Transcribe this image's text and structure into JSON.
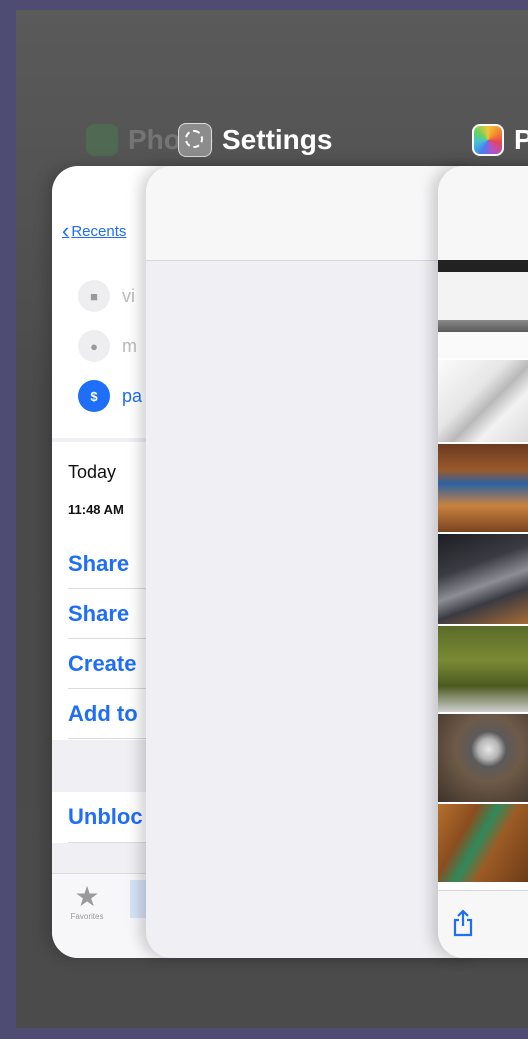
{
  "app_switcher": {
    "apps": [
      {
        "name": "Phone",
        "icon": "phone-icon",
        "dimmed": true
      },
      {
        "name": "Settings",
        "icon": "settings-gear-icon",
        "dimmed": false
      },
      {
        "name": "Photos",
        "icon": "photos-icon",
        "dimmed": false
      }
    ]
  },
  "phone_card": {
    "back_label": "Recents",
    "actions": [
      {
        "icon": "video-icon",
        "label": "vi"
      },
      {
        "icon": "message-icon",
        "label": "m"
      },
      {
        "icon": "pay-icon",
        "glyph": "$",
        "label": "pa"
      }
    ],
    "date_label": "Today",
    "time_label": "11:48 AM",
    "links": [
      "Share",
      "Share",
      "Create",
      "Add to"
    ],
    "unblock_label": "Unbloc",
    "tab_favorites": "Favorites"
  },
  "colors": {
    "background": "#4e4c72",
    "ios_blue": "#1e6ef7",
    "phone_green": "#3cc24a"
  }
}
